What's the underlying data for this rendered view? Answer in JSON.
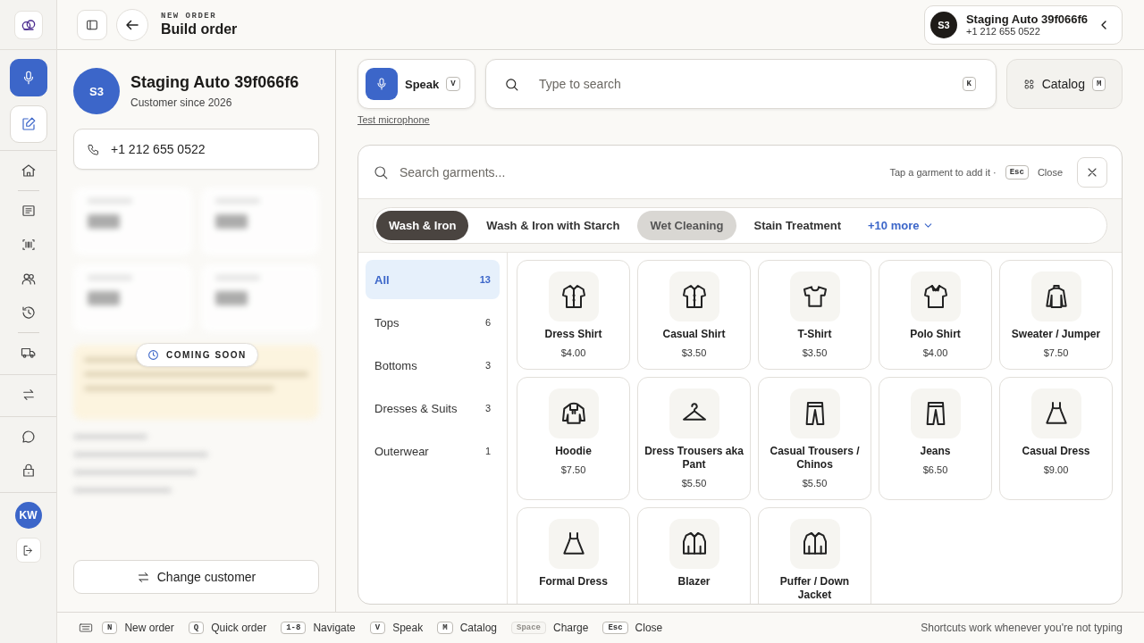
{
  "rail": {
    "actions": [
      {
        "selected": true
      },
      {
        "selected": false
      }
    ],
    "avatar": "KW"
  },
  "header": {
    "eyebrow": "NEW ORDER",
    "title": "Build order",
    "customer_chip": {
      "initials": "S3",
      "name": "Staging Auto 39f066f6",
      "phone": "+1 212 655 0522"
    }
  },
  "customer": {
    "initials": "S3",
    "name": "Staging Auto 39f066f6",
    "since": "Customer since 2026",
    "phone": "+1 212 655 0522",
    "badge": "COMING SOON",
    "change_button": "Change customer"
  },
  "toolbar": {
    "speak": {
      "label": "Speak",
      "key": "V"
    },
    "search": {
      "placeholder": "Type to search",
      "key": "K"
    },
    "catalog": {
      "label": "Catalog",
      "key": "M"
    },
    "test_link": "Test microphone"
  },
  "garments": {
    "search_placeholder": "Search garments...",
    "hint": "Tap a garment to add it ·",
    "esc_key": "Esc",
    "close_label": "Close",
    "services": [
      {
        "label": "Wash & Iron",
        "selected": true,
        "highlighted": false
      },
      {
        "label": "Wash & Iron with Starch",
        "selected": false,
        "highlighted": false
      },
      {
        "label": "Wet Cleaning",
        "selected": false,
        "highlighted": true
      },
      {
        "label": "Stain Treatment",
        "selected": false,
        "highlighted": false
      }
    ],
    "more": "+10 more",
    "categories": [
      {
        "label": "All",
        "count": "13",
        "selected": true
      },
      {
        "label": "Tops",
        "count": "6",
        "selected": false
      },
      {
        "label": "Bottoms",
        "count": "3",
        "selected": false
      },
      {
        "label": "Dresses & Suits",
        "count": "3",
        "selected": false
      },
      {
        "label": "Outerwear",
        "count": "1",
        "selected": false
      }
    ],
    "items": [
      {
        "kind": "shirt",
        "name": "Dress Shirt",
        "price": "$4.00"
      },
      {
        "kind": "shirt",
        "name": "Casual Shirt",
        "price": "$3.50"
      },
      {
        "kind": "tshirt",
        "name": "T-Shirt",
        "price": "$3.50"
      },
      {
        "kind": "polo",
        "name": "Polo Shirt",
        "price": "$4.00"
      },
      {
        "kind": "sweater",
        "name": "Sweater / Jumper",
        "price": "$7.50"
      },
      {
        "kind": "hoodie",
        "name": "Hoodie",
        "price": "$7.50"
      },
      {
        "kind": "hanger",
        "name": "Dress Trousers aka Pant",
        "price": "$5.50"
      },
      {
        "kind": "trousers",
        "name": "Casual Trousers / Chinos",
        "price": "$5.50"
      },
      {
        "kind": "trousers",
        "name": "Jeans",
        "price": "$6.50"
      },
      {
        "kind": "dress",
        "name": "Casual Dress",
        "price": "$9.00"
      },
      {
        "kind": "dress",
        "name": "Formal Dress"
      },
      {
        "kind": "jacket",
        "name": "Blazer"
      },
      {
        "kind": "jacket",
        "name": "Puffer / Down Jacket"
      }
    ]
  },
  "status_bar": {
    "shortcuts": [
      {
        "key": "N",
        "label": "New order",
        "disabled": false
      },
      {
        "key": "Q",
        "label": "Quick order",
        "disabled": false
      },
      {
        "key": "1-8",
        "label": "Navigate",
        "disabled": false
      },
      {
        "key": "V",
        "label": "Speak",
        "disabled": false
      },
      {
        "key": "M",
        "label": "Catalog",
        "disabled": false
      },
      {
        "key": "Space",
        "label": "Charge",
        "disabled": true
      },
      {
        "key": "Esc",
        "label": "Close",
        "disabled": false
      }
    ],
    "note": "Shortcuts work whenever you're not typing"
  }
}
